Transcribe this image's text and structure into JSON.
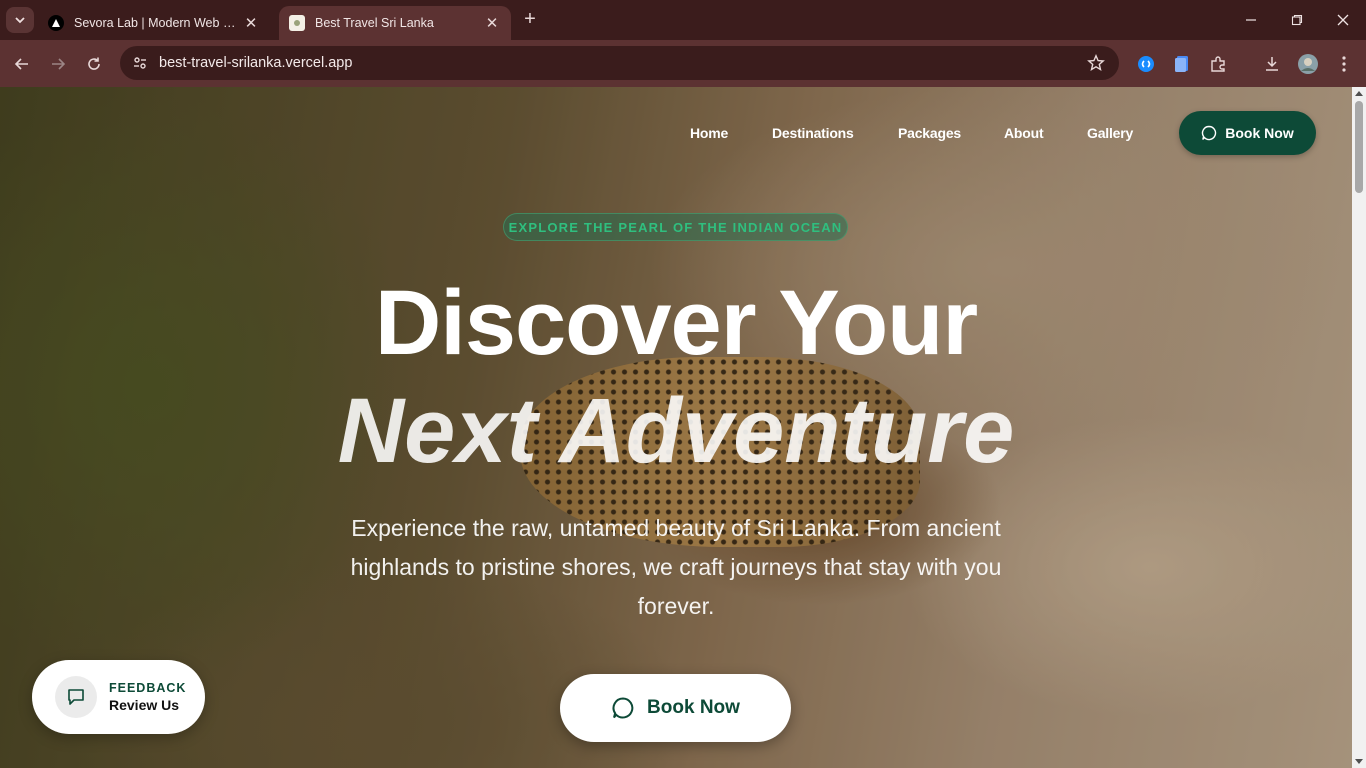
{
  "browser": {
    "tabs": [
      {
        "title": "Sevora Lab | Modern Web Solutions",
        "active": false,
        "close": "✕"
      },
      {
        "title": "Best Travel Sri Lanka",
        "active": true,
        "close": "✕"
      }
    ],
    "new_tab": "+",
    "url": "best-travel-srilanka.vercel.app",
    "icons": [
      "tab-search-icon",
      "back-icon",
      "forward-icon",
      "reload-icon",
      "site-info-icon",
      "bookmark-star-icon",
      "extension-icon",
      "downloads-icon",
      "profile-avatar",
      "menu-icon",
      "minimize-icon",
      "maximize-icon",
      "close-window-icon"
    ]
  },
  "site": {
    "nav": {
      "links": [
        "Home",
        "Destinations",
        "Packages",
        "About",
        "Gallery"
      ],
      "book_label": "Book Now"
    },
    "hero": {
      "badge": "EXPLORE THE PEARL OF THE INDIAN OCEAN",
      "headline_line1": "Discover Your",
      "headline_line2": "Next Adventure",
      "subtitle": "Experience the raw, untamed beauty of Sri Lanka. From ancient highlands to pristine shores, we craft journeys that stay with you forever.",
      "cta_label": "Book Now"
    },
    "feedback": {
      "top": "FEEDBACK",
      "bottom": "Review Us"
    }
  },
  "colors": {
    "brand_green": "#0d4a37",
    "badge_text": "#2fbf7f",
    "chrome_bg": "#3b1c1c",
    "toolbar_bg": "#5c3232"
  }
}
